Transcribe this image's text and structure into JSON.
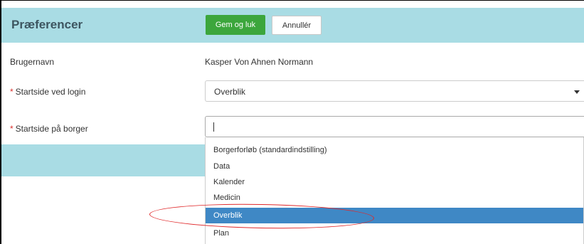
{
  "header": {
    "title": "Præferencer",
    "save_label": "Gem og luk",
    "cancel_label": "Annullér"
  },
  "form": {
    "username_label": "Brugernavn",
    "username_value": "Kasper Von Ahnen Normann",
    "required_marker": "*",
    "login_start_label": "Startside ved login",
    "login_start_value": "Overblik",
    "citizen_start_label": "Startside på borger",
    "citizen_start_value": ""
  },
  "dropdown": {
    "options": [
      "Borgerforløb (standardindstilling)",
      "Data",
      "Kalender",
      "Medicin",
      "Overblik",
      "Plan"
    ],
    "selected": "Overblik"
  },
  "colors": {
    "header_bg": "#a9dce4",
    "save_button": "#3ca63c",
    "selected_option": "#3f88c5",
    "annotation": "#e0282a",
    "required": "#d9302c"
  }
}
